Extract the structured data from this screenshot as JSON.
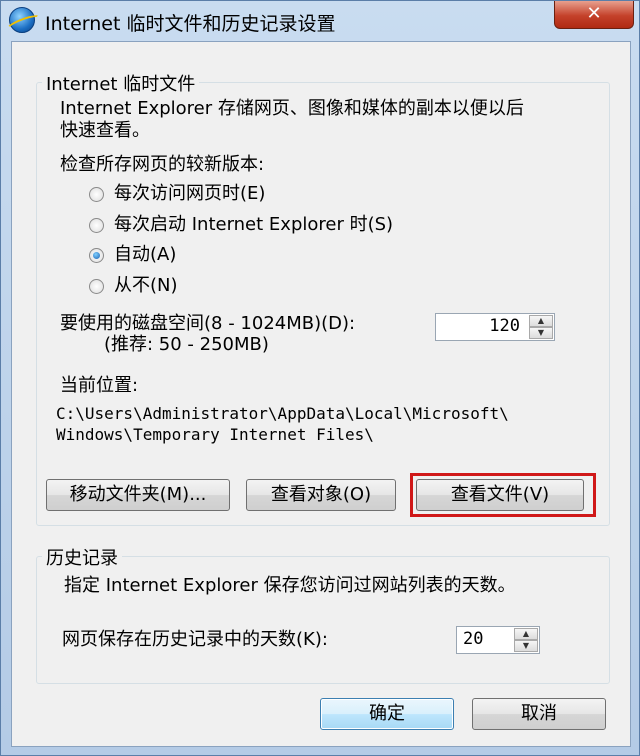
{
  "window": {
    "title": "Internet 临时文件和历史记录设置",
    "close_label": "✕",
    "app_icon": "ie-globe-icon"
  },
  "temp_files": {
    "legend": "Internet 临时文件",
    "description_line1": "Internet Explorer 存储网页、图像和媒体的副本以便以后",
    "description_line2": "快速查看。",
    "check_label": "检查所存网页的较新版本:",
    "options": [
      {
        "label": "每次访问网页时(E)",
        "checked": false
      },
      {
        "label": "每次启动 Internet Explorer 时(S)",
        "checked": false
      },
      {
        "label": "自动(A)",
        "checked": true
      },
      {
        "label": "从不(N)",
        "checked": false
      }
    ],
    "disk_label": "要使用的磁盘空间(8 - 1024MB)(D):",
    "disk_hint": "(推荐: 50 - 250MB)",
    "disk_value": "120",
    "location_label": "当前位置:",
    "location_line1": "C:\\Users\\Administrator\\AppData\\Local\\Microsoft\\",
    "location_line2": "Windows\\Temporary Internet Files\\",
    "buttons": {
      "move_folder": "移动文件夹(M)...",
      "view_objects": "查看对象(O)",
      "view_files": "查看文件(V)"
    }
  },
  "history": {
    "legend": "历史记录",
    "description": "指定 Internet Explorer 保存您访问过网站列表的天数。",
    "days_label": "网页保存在历史记录中的天数(K):",
    "days_value": "20"
  },
  "footer": {
    "ok_label": "确定",
    "cancel_label": "取消"
  },
  "colors": {
    "highlight": "#d01818",
    "accent": "#3c7fb1"
  }
}
